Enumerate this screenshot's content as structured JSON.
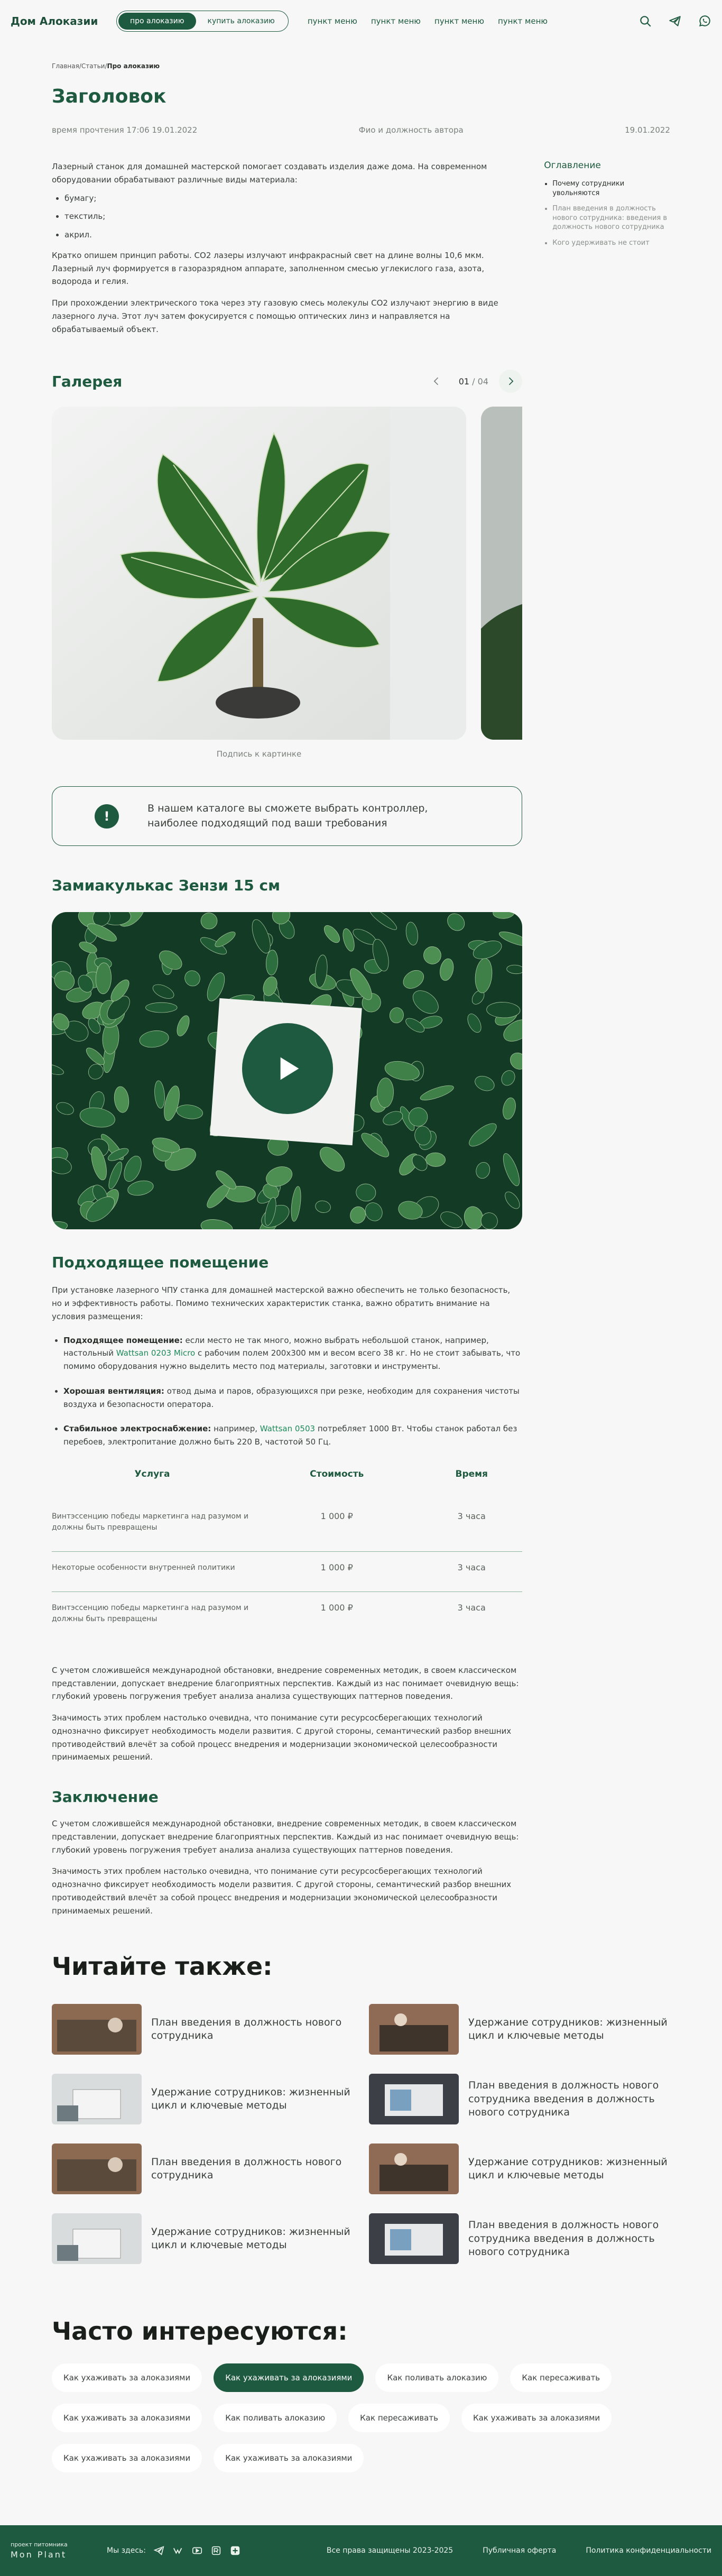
{
  "header": {
    "logo": "Дом Алоказии",
    "segments": [
      "про алоказию",
      "купить алоказию"
    ],
    "nav": [
      "пункт меню",
      "пункт меню",
      "пункт меню",
      "пункт меню"
    ],
    "icons": [
      "search-icon",
      "telegram-icon",
      "whatsapp-icon"
    ]
  },
  "breadcrumb": {
    "home": "Главная",
    "sep1": "/",
    "articles": "Статьи",
    "sep2": "/",
    "current": "Про алоказию"
  },
  "article": {
    "title": "Заголовок",
    "reading_time": "время прочтения 17:06 19.01.2022",
    "author": "Фио и должность автора",
    "date": "19.01.2022",
    "intro_p1": "Лазерный станок для домашней мастерской помогает создавать изделия даже дома. На современном оборудовании обрабатывают различные виды материала:",
    "intro_list": [
      "бумагу;",
      "текстиль;",
      "акрил."
    ],
    "intro_p2": "Кратко опишем принцип работы. СО2 лазеры излучают инфракрасный свет на длине волны 10,6 мкм. Лазерный луч формируется в газоразрядном аппарате, заполненном смесью углекислого газа, азота, водорода и гелия.",
    "intro_p3": "При прохождении электрического тока через эту газовую смесь молекулы СО2 излучают энергию в виде лазерного луча. Этот луч затем фокусируется с помощью оптических линз и направляется на обрабатываемый объект."
  },
  "toc": {
    "title": "Оглавление",
    "items": [
      "Почему сотрудники увольняются",
      "План введения в должность нового сотрудника: введения в должность нового сотрудника",
      "Кого удерживать не стоит"
    ]
  },
  "gallery": {
    "title": "Галерея",
    "current": "01",
    "sep": "/",
    "total": "04",
    "caption": "Подпись к картинке"
  },
  "callout": {
    "icon": "!",
    "text": "В нашем каталоге вы сможете выбрать контроллер, наиболее подходящий под ваши требования"
  },
  "video": {
    "title": "Замиакулькас Зензи 15 см"
  },
  "room": {
    "title": "Подходящее помещение",
    "p1": "При установке лазерного ЧПУ станка для домашней мастерской важно обеспечить не только безопасность, но и эффективность работы. Помимо технических характеристик станка, важно обратить внимание на условия размещения:",
    "b1_title": "Подходящее помещение:",
    "b1_text1": " если место не так много, можно выбрать небольшой станок, например, настольный ",
    "b1_link": "Wattsan 0203 Micro",
    "b1_text2": " с рабочим полем 200х300 мм и весом всего 38 кг. Но не стоит забывать, что помимо оборудования нужно выделить место под материалы, заготовки и инструменты.",
    "b2_title": "Хорошая вентиляция:",
    "b2_text": " отвод дыма и паров, образующихся при резке, необходим для сохранения чистоты воздуха и безопасности оператора.",
    "b3_title": "Стабильное электроснабжение:",
    "b3_text1": " например, ",
    "b3_link": "Wattsan 0503",
    "b3_text2": " потребляет 1000 Вт. Чтобы станок работал без перебоев, электропитание должно быть 220 В, частотой 50 Гц."
  },
  "table": {
    "headers": [
      "Услуга",
      "Стоимость",
      "Время"
    ],
    "rows": [
      {
        "service": "Винтэссенцию победы маркетинга над разумом и должны быть превращены",
        "price": "1 000 ₽",
        "time": "3 часа"
      },
      {
        "service": "Некоторые особенности внутренней политики",
        "price": "1 000 ₽",
        "time": "3 часа"
      },
      {
        "service": "Винтэссенцию победы маркетинга над разумом и должны быть превращены",
        "price": "1 000 ₽",
        "time": "3 часа"
      }
    ]
  },
  "after_table": {
    "p1": "С учетом сложившейся международной обстановки, внедрение современных методик, в своем классическом представлении, допускает внедрение благоприятных перспектив. Каждый из нас понимает очевидную вещь: глубокий уровень погружения требует анализа анализа существующих паттернов поведения.",
    "p2": "Значимость этих проблем настолько очевидна, что понимание сути ресурсосберегающих технологий однозначно фиксирует необходимость модели развития. С другой стороны, семантический разбор внешних противодействий влечёт за собой процесс внедрения и модернизации экономической целесообразности принимаемых решений."
  },
  "conclusion": {
    "title": "Заключение",
    "p1": "С учетом сложившейся международной обстановки, внедрение современных методик, в своем классическом представлении, допускает внедрение благоприятных перспектив. Каждый из нас понимает очевидную вещь: глубокий уровень погружения требует анализа анализа существующих паттернов поведения.",
    "p2": "Значимость этих проблем настолько очевидна, что понимание сути ресурсосберегающих технологий однозначно фиксирует необходимость модели развития. С другой стороны, семантический разбор внешних противодействий влечёт за собой процесс внедрения и модернизации экономической целесообразности принимаемых решений."
  },
  "read_also": {
    "title": "Читайте также:",
    "items": [
      "План введения в должность нового сотрудника",
      "Удержание сотрудников: жизненный цикл и ключевые методы",
      "Удержание сотрудников: жизненный цикл и ключевые методы",
      "План введения в должность нового сотрудника  введения в должность нового сотрудника",
      "План введения в должность нового сотрудника",
      "Удержание сотрудников: жизненный цикл и ключевые методы",
      "Удержание сотрудников: жизненный цикл и ключевые методы",
      "План введения в должность нового сотрудника  введения в должность нового сотрудника"
    ]
  },
  "faq": {
    "title": "Часто интересуются:",
    "chips": [
      "Как ухаживать за алоказиями",
      "Как ухаживать за алоказиями",
      "Как поливать алоказию",
      "Как пересаживать",
      "Как ухаживать за алоказиями",
      "Как поливать алоказию",
      "Как пересаживать",
      "Как ухаживать за алоказиями",
      "Как ухаживать за алоказиями",
      "Как ухаживать за алоказиями"
    ],
    "active_index": 1
  },
  "footer": {
    "tagline": "проект питомника",
    "brand": "Mon Plant",
    "find_us": "Мы здесь:",
    "rights": "Все права защищены 2023-2025",
    "offer": "Публичная оферта",
    "privacy": "Политика конфиденциальности"
  },
  "colors": {
    "brand": "#1e5a40",
    "link": "#1e8a5a",
    "bg": "#f6f7f6"
  }
}
